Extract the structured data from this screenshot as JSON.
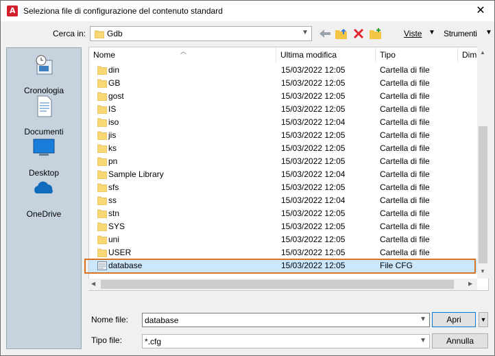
{
  "window": {
    "title": "Seleziona file di configurazione del contenuto standard",
    "close": "✕"
  },
  "toolbar": {
    "look_in_label": "Cerca in:",
    "look_in_value": "Gdb",
    "views_label": "Viste",
    "tools_label": "Strumenti"
  },
  "places": [
    {
      "label": "Cronologia",
      "icon": "history-icon"
    },
    {
      "label": "Documenti",
      "icon": "documents-icon"
    },
    {
      "label": "Desktop",
      "icon": "desktop-icon"
    },
    {
      "label": "OneDrive",
      "icon": "onedrive-icon"
    }
  ],
  "columns": {
    "name": "Nome",
    "modified": "Ultima modifica",
    "type": "Tipo",
    "size": "Dim"
  },
  "files": [
    {
      "name": "din",
      "modified": "15/03/2022 12:05",
      "type": "Cartella di file",
      "kind": "folder"
    },
    {
      "name": "GB",
      "modified": "15/03/2022 12:05",
      "type": "Cartella di file",
      "kind": "folder"
    },
    {
      "name": "gost",
      "modified": "15/03/2022 12:05",
      "type": "Cartella di file",
      "kind": "folder"
    },
    {
      "name": "IS",
      "modified": "15/03/2022 12:05",
      "type": "Cartella di file",
      "kind": "folder"
    },
    {
      "name": "iso",
      "modified": "15/03/2022 12:04",
      "type": "Cartella di file",
      "kind": "folder"
    },
    {
      "name": "jis",
      "modified": "15/03/2022 12:05",
      "type": "Cartella di file",
      "kind": "folder"
    },
    {
      "name": "ks",
      "modified": "15/03/2022 12:05",
      "type": "Cartella di file",
      "kind": "folder"
    },
    {
      "name": "pn",
      "modified": "15/03/2022 12:05",
      "type": "Cartella di file",
      "kind": "folder"
    },
    {
      "name": "Sample Library",
      "modified": "15/03/2022 12:04",
      "type": "Cartella di file",
      "kind": "folder"
    },
    {
      "name": "sfs",
      "modified": "15/03/2022 12:05",
      "type": "Cartella di file",
      "kind": "folder"
    },
    {
      "name": "ss",
      "modified": "15/03/2022 12:04",
      "type": "Cartella di file",
      "kind": "folder"
    },
    {
      "name": "stn",
      "modified": "15/03/2022 12:05",
      "type": "Cartella di file",
      "kind": "folder"
    },
    {
      "name": "SYS",
      "modified": "15/03/2022 12:05",
      "type": "Cartella di file",
      "kind": "folder"
    },
    {
      "name": "uni",
      "modified": "15/03/2022 12:05",
      "type": "Cartella di file",
      "kind": "folder"
    },
    {
      "name": "USER",
      "modified": "15/03/2022 12:05",
      "type": "Cartella di file",
      "kind": "folder"
    },
    {
      "name": "database",
      "modified": "15/03/2022 12:05",
      "type": "File CFG",
      "kind": "file",
      "selected": true
    }
  ],
  "filename": {
    "label": "Nome file:",
    "value": "database"
  },
  "filetype": {
    "label": "Tipo file:",
    "value": "*.cfg"
  },
  "buttons": {
    "open": "Apri",
    "cancel": "Annulla"
  },
  "colors": {
    "selection": "#cce8ff",
    "highlight_outline": "#d9731f",
    "places_bg": "#c6d3df",
    "folder": "#f8d775"
  }
}
